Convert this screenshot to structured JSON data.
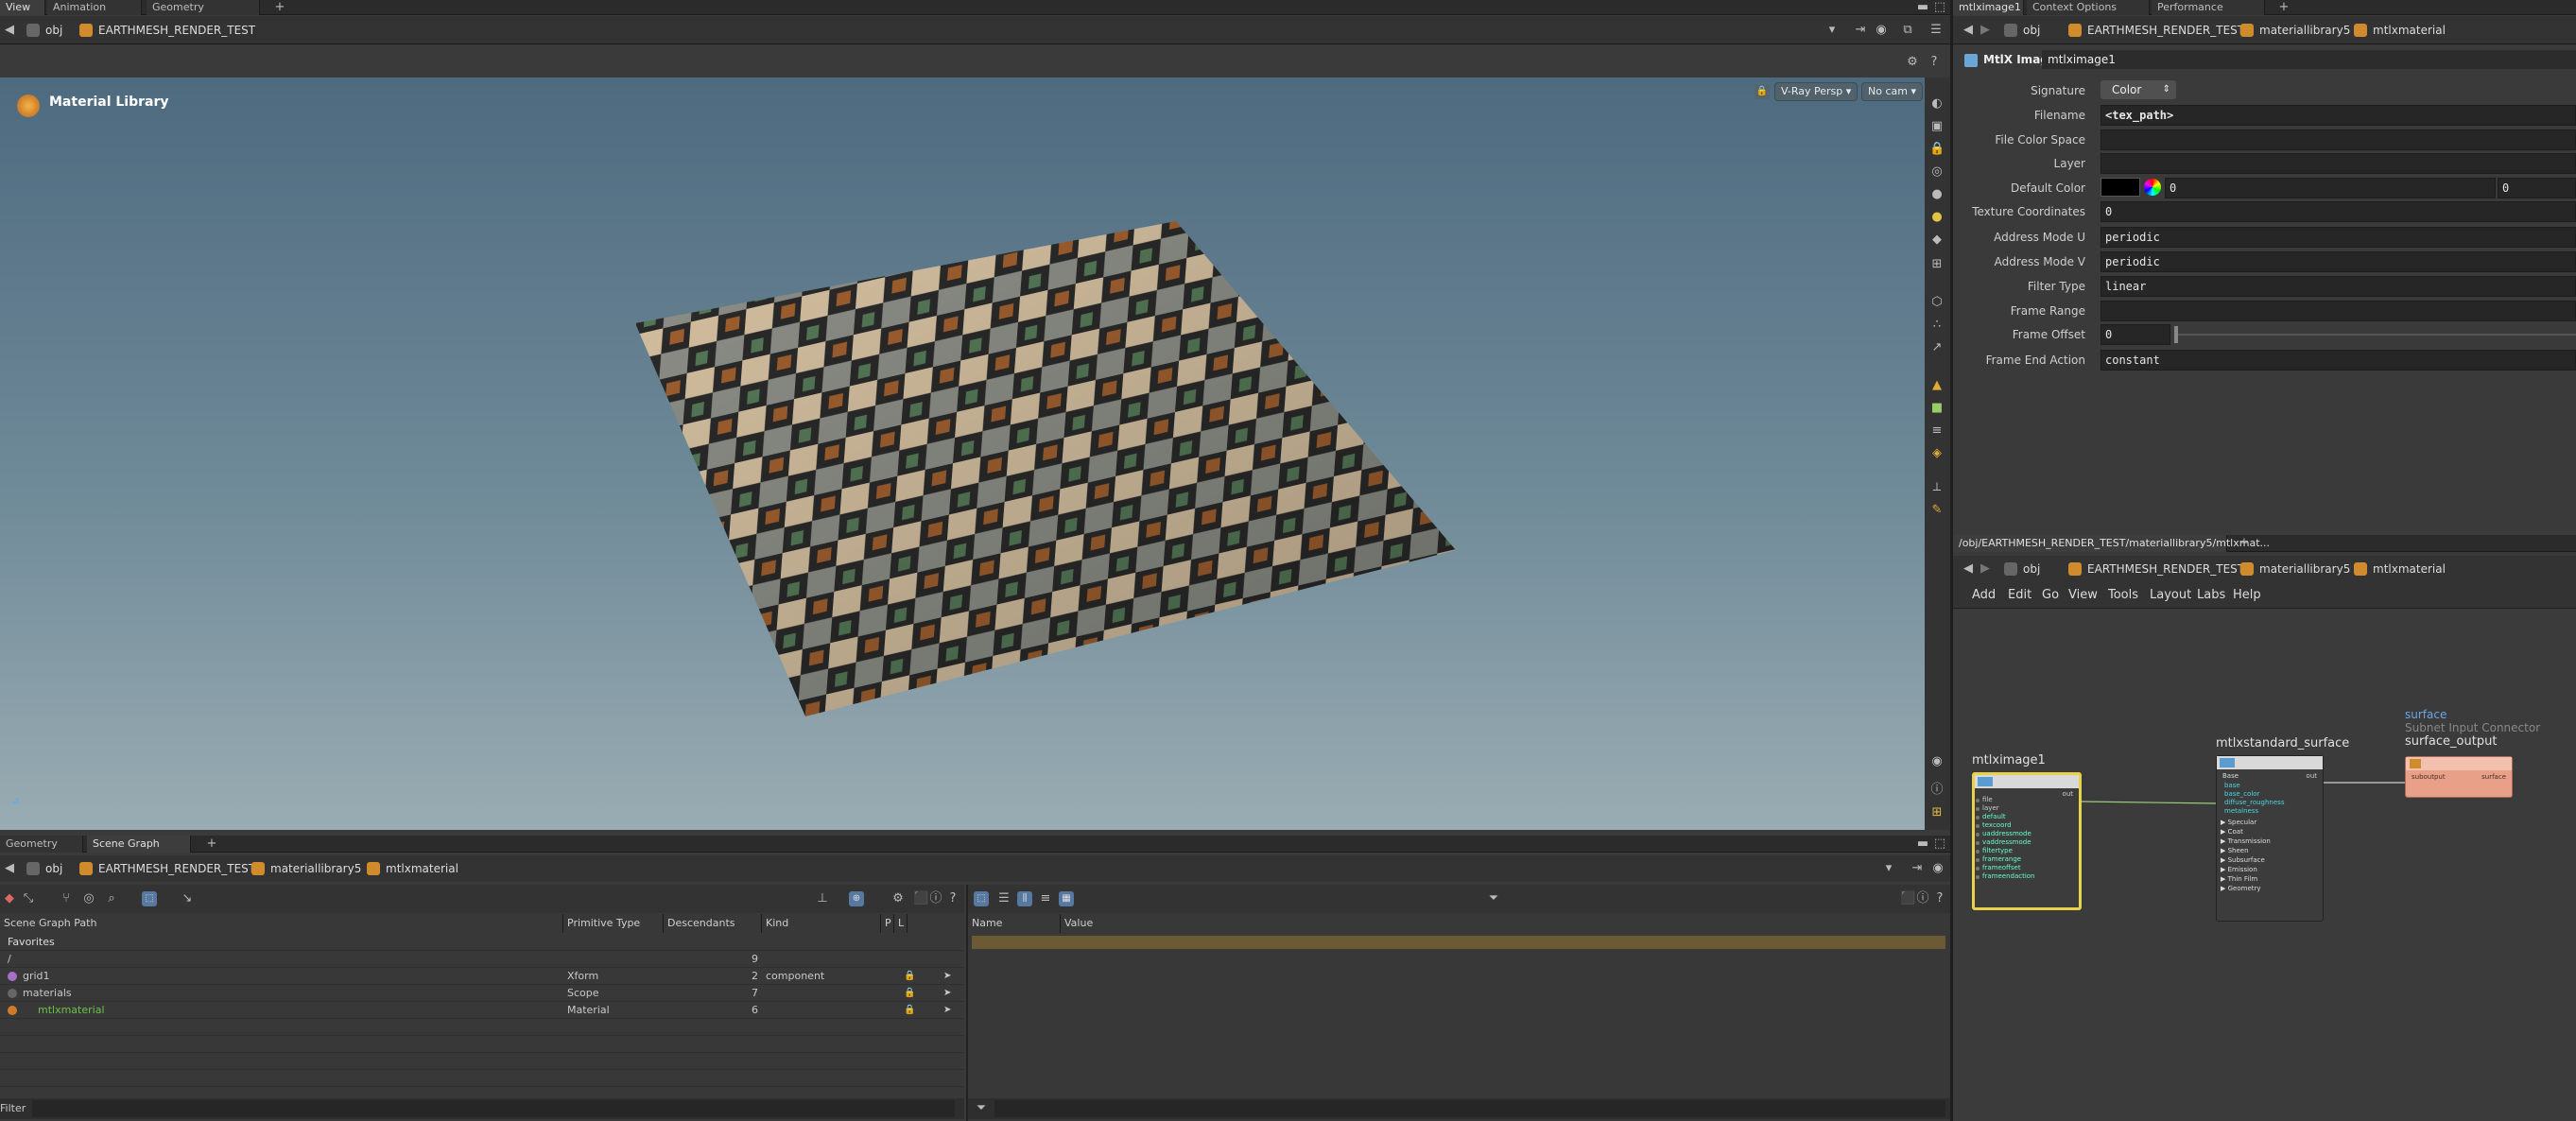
{
  "top_tabs_left": [
    "View",
    "Animation Editor",
    "Geometry Spreadsheet"
  ],
  "top_tabs_right": [
    "mtlximage1",
    "Context Options Editor",
    "Performance Monitor"
  ],
  "viewport": {
    "path": [
      "obj",
      "EARTHMESH_RENDER_TEST"
    ],
    "title": "Material Library",
    "camera_menu": "V-Ray Persp",
    "cam_menu": "No cam"
  },
  "params": {
    "path": [
      "obj",
      "EARTHMESH_RENDER_TEST",
      "materiallibrary5",
      "mtlxmaterial"
    ],
    "node_type": "MtlX Image",
    "node_name": "mtlximage1",
    "rows": [
      {
        "label": "Signature",
        "value": "Color",
        "kind": "menu"
      },
      {
        "label": "Filename",
        "value": "<tex_path>",
        "kind": "text"
      },
      {
        "label": "File Color Space",
        "value": "",
        "kind": "text"
      },
      {
        "label": "Layer",
        "value": "",
        "kind": "text"
      },
      {
        "label": "Default Color",
        "value": "0",
        "value2": "0",
        "kind": "color"
      },
      {
        "label": "Texture Coordinates",
        "value": "0",
        "kind": "text"
      },
      {
        "label": "Address Mode U",
        "value": "periodic",
        "kind": "text"
      },
      {
        "label": "Address Mode V",
        "value": "periodic",
        "kind": "text"
      },
      {
        "label": "Filter Type",
        "value": "linear",
        "kind": "text"
      },
      {
        "label": "Frame Range",
        "value": "",
        "kind": "text"
      },
      {
        "label": "Frame Offset",
        "value": "0",
        "kind": "slider"
      },
      {
        "label": "Frame End Action",
        "value": "constant",
        "kind": "text"
      }
    ]
  },
  "network": {
    "tab_path": "/obj/EARTHMESH_RENDER_TEST/materiallibrary5/mtlxmat...",
    "path": [
      "obj",
      "EARTHMESH_RENDER_TEST",
      "materiallibrary5",
      "mtlxmaterial"
    ],
    "menu": [
      "Add",
      "Edit",
      "Go",
      "View",
      "Tools",
      "Layout",
      "Labs",
      "Help"
    ],
    "nodes": {
      "image": {
        "name": "mtlximage1",
        "out": "out",
        "inputs": [
          "file",
          "layer",
          "default",
          "texcoord",
          "uaddressmode",
          "vaddressmode",
          "filtertype",
          "framerange",
          "frameoffset",
          "frameendaction"
        ]
      },
      "standard": {
        "name": "mtlxstandard_surface",
        "out": "out",
        "base_header": "Base",
        "inputs": [
          "base",
          "base_color",
          "diffuse_roughness",
          "metalness"
        ],
        "sections": [
          "Specular",
          "Coat",
          "Transmission",
          "Sheen",
          "Subsurface",
          "Emission",
          "Thin Film",
          "Geometry"
        ]
      },
      "output": {
        "name": "surface_output",
        "context": "surface",
        "subtitle": "Subnet Input Connector",
        "in": "suboutput",
        "out": "surface"
      }
    }
  },
  "bottom_tabs": [
    "Geometry Spreadsheet",
    "Scene Graph Layers"
  ],
  "bottom_path": [
    "obj",
    "EARTHMESH_RENDER_TEST",
    "materiallibrary5",
    "mtlxmaterial"
  ],
  "scene_graph": {
    "columns": [
      "Scene Graph Path",
      "Primitive Type",
      "Descendants",
      "Kind",
      "P",
      "L"
    ],
    "favorites": "Favorites",
    "rows": [
      {
        "name": "/",
        "type": "",
        "desc": "9",
        "kind": ""
      },
      {
        "name": "grid1",
        "type": "Xform",
        "desc": "2",
        "kind": "component"
      },
      {
        "name": "materials",
        "type": "Scope",
        "desc": "7",
        "kind": ""
      },
      {
        "name": "mtlxmaterial",
        "type": "Material",
        "desc": "6",
        "kind": ""
      }
    ],
    "filter_label": "Filter"
  },
  "properties": {
    "columns": [
      "Name",
      "Value"
    ]
  },
  "colors": {
    "accent_orange": "#d08b2c",
    "selected_node": "#e8d24a",
    "material_green": "#6cc24a",
    "output_node": "#e8a089"
  }
}
